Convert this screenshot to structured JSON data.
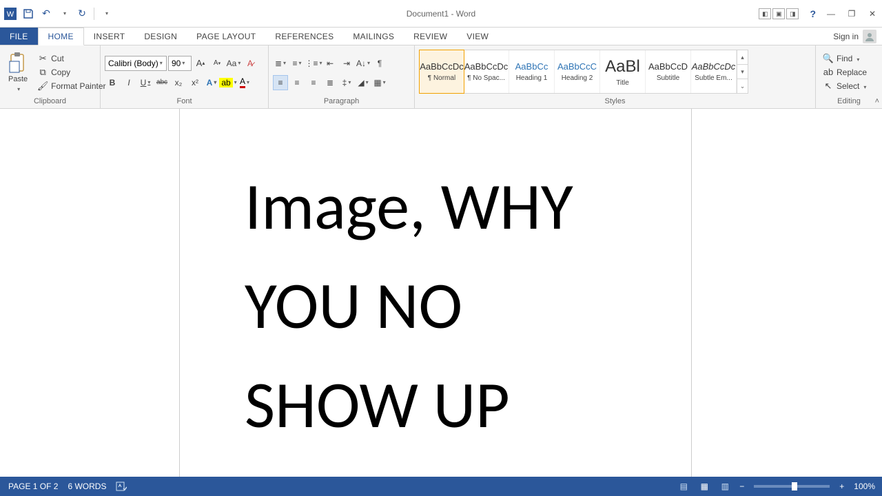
{
  "title": "Document1 - Word",
  "qa": {
    "undo": "↶",
    "redo": "↻"
  },
  "tabs": {
    "file": "FILE",
    "home": "HOME",
    "insert": "INSERT",
    "design": "DESIGN",
    "page_layout": "PAGE LAYOUT",
    "references": "REFERENCES",
    "mailings": "MAILINGS",
    "review": "REVIEW",
    "view": "VIEW"
  },
  "signin": "Sign in",
  "clipboard": {
    "paste": "Paste",
    "cut": "Cut",
    "copy": "Copy",
    "format_painter": "Format Painter",
    "label": "Clipboard"
  },
  "font": {
    "name": "Calibri (Body)",
    "size": "90",
    "label": "Font",
    "bold": "B",
    "italic": "I",
    "underline": "U",
    "strike": "abc",
    "sub": "x₂",
    "sup": "x²"
  },
  "paragraph": {
    "label": "Paragraph"
  },
  "styles": {
    "label": "Styles",
    "items": [
      {
        "preview": "AaBbCcDc",
        "name": "¶ Normal",
        "blue": false,
        "sel": true
      },
      {
        "preview": "AaBbCcDc",
        "name": "¶ No Spac...",
        "blue": false,
        "sel": false
      },
      {
        "preview": "AaBbCc",
        "name": "Heading 1",
        "blue": true,
        "sel": false
      },
      {
        "preview": "AaBbCcC",
        "name": "Heading 2",
        "blue": true,
        "sel": false
      },
      {
        "preview": "AaBl",
        "name": "Title",
        "blue": false,
        "sel": false,
        "big": true
      },
      {
        "preview": "AaBbCcD",
        "name": "Subtitle",
        "blue": false,
        "sel": false
      },
      {
        "preview": "AaBbCcDc",
        "name": "Subtle Em...",
        "blue": false,
        "sel": false,
        "italic": true
      }
    ]
  },
  "editing": {
    "label": "Editing",
    "find": "Find",
    "replace": "Replace",
    "select": "Select"
  },
  "document": {
    "text": "Image, WHY YOU NO SHOW UP"
  },
  "status": {
    "page": "PAGE 1 OF 2",
    "words": "6 WORDS",
    "zoom": "100%"
  }
}
